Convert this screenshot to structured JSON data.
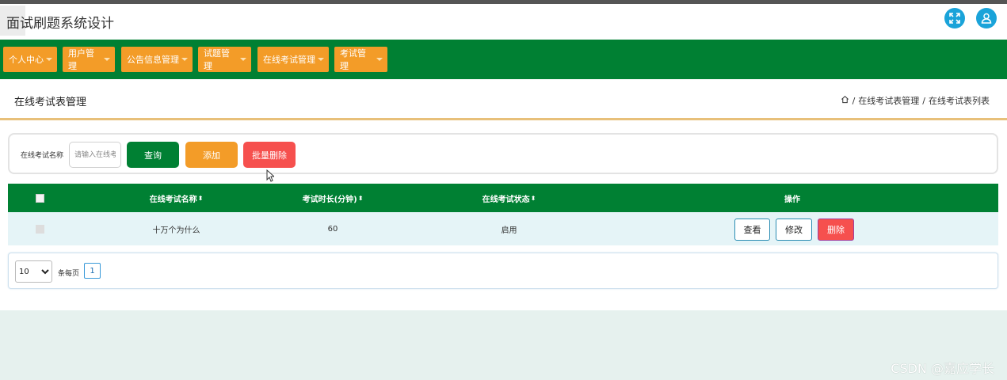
{
  "header": {
    "title": "面试刷题系统设计"
  },
  "colors": {
    "primary": "#008033",
    "accent": "#f39c28",
    "danger": "#f6504e",
    "round_button": "#1aa3d9"
  },
  "nav": {
    "items": [
      {
        "label": "个人中心"
      },
      {
        "label": "用户管理"
      },
      {
        "label": "公告信息管理"
      },
      {
        "label": "试题管理"
      },
      {
        "label": "在线考试管理"
      },
      {
        "label": "考试管理"
      }
    ]
  },
  "breadcrumb": {
    "page_title": "在线考试表管理",
    "path": [
      "在线考试表管理",
      "在线考试表列表"
    ],
    "sep": "/"
  },
  "search": {
    "label": "在线考试名称",
    "placeholder": "请输入在线考",
    "query_label": "查询",
    "add_label": "添加",
    "batch_delete_label": "批量删除"
  },
  "table": {
    "columns": [
      "在线考试名称",
      "考试时长(分钟)",
      "在线考试状态",
      "操作"
    ],
    "sort_glyph": "⬍",
    "rows": [
      {
        "name": "十万个为什么",
        "duration": "60",
        "status": "启用"
      }
    ],
    "actions": {
      "view": "查看",
      "edit": "修改",
      "delete": "删除"
    }
  },
  "pager": {
    "page_size": "10",
    "per_page_label": "条每页",
    "current_page": "1"
  },
  "watermark": "CSDN @嘉应学长"
}
